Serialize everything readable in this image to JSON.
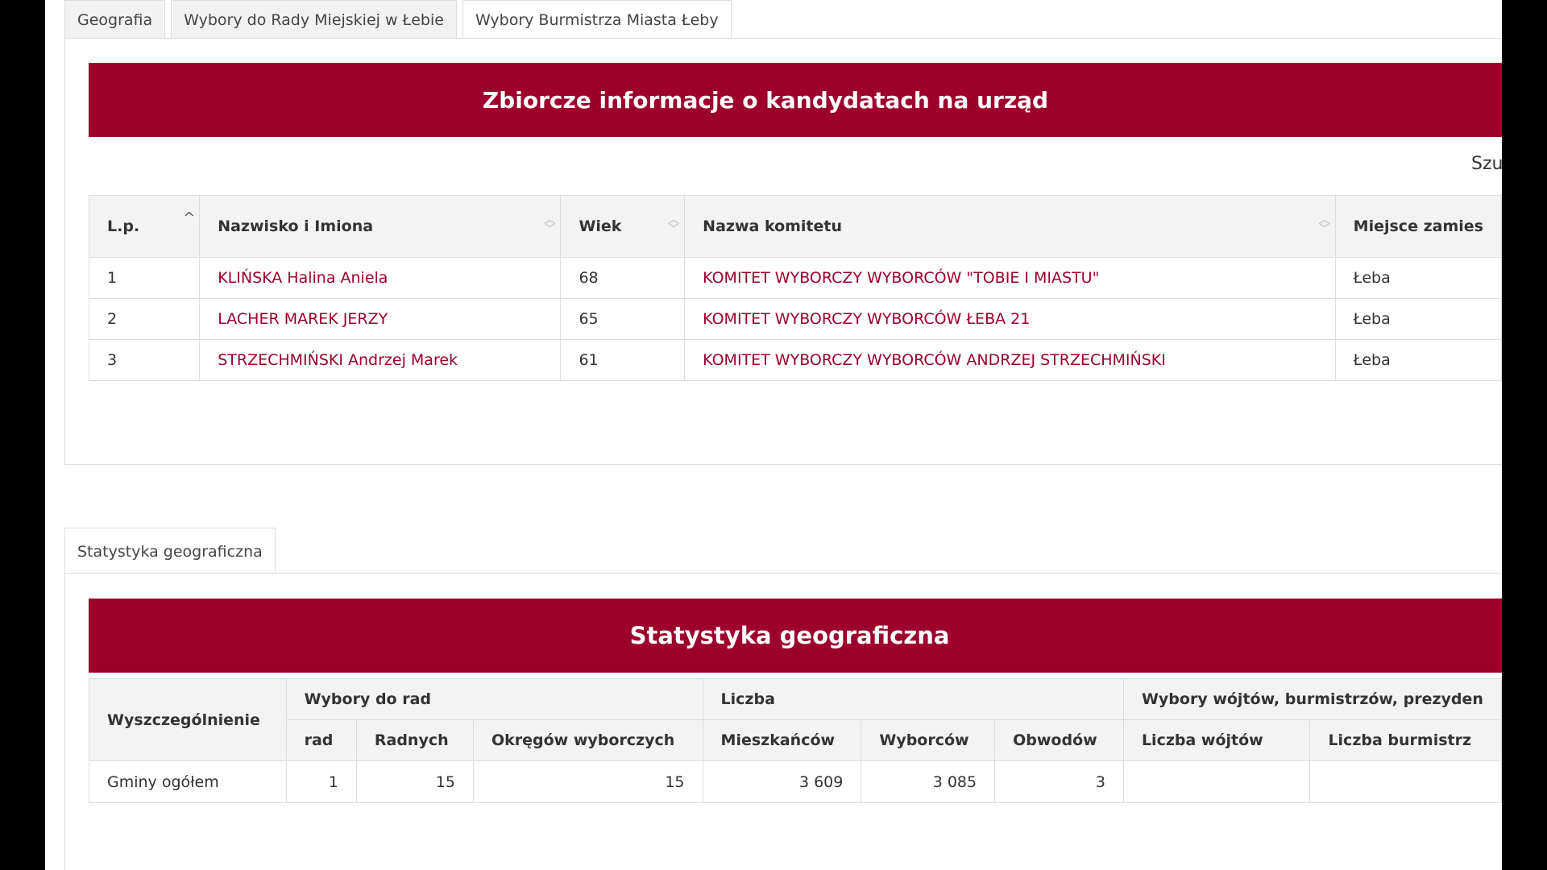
{
  "top_tabs": [
    {
      "label": "Geografia"
    },
    {
      "label": "Wybory do Rady Miejskiej w Łebie"
    },
    {
      "label": "Wybory Burmistrza Miasta Łeby"
    }
  ],
  "candidates": {
    "title": "Zbiorcze informacje o kandydatach na urząd",
    "search_label": "Szu",
    "columns": [
      "L.p.",
      "Nazwisko i Imiona",
      "Wiek",
      "Nazwa komitetu",
      "Miejsce zamies"
    ],
    "rows": [
      {
        "lp": "1",
        "name": "KLIŃSKA Halina Aniela",
        "age": "68",
        "committee": "KOMITET WYBORCZY WYBORCÓW \"TOBIE I MIASTU\"",
        "place": "Łeba"
      },
      {
        "lp": "2",
        "name": "LACHER MAREK JERZY",
        "age": "65",
        "committee": "KOMITET WYBORCZY WYBORCÓW ŁEBA 21",
        "place": "Łeba"
      },
      {
        "lp": "3",
        "name": "STRZECHMIŃSKI Andrzej Marek",
        "age": "61",
        "committee": "KOMITET WYBORCZY WYBORCÓW ANDRZEJ STRZECHMIŃSKI",
        "place": "Łeba"
      }
    ]
  },
  "bottom_tabs": [
    {
      "label": "Statystyka geograficzna"
    }
  ],
  "geo_stats": {
    "title": "Statystyka geograficzna",
    "group_headers": {
      "detail": "Wyszczególnienie",
      "councils": "Wybory do rad",
      "count": "Liczba",
      "mayors": "Wybory wójtów, burmistrzów, prezyden"
    },
    "sub_headers": [
      "rad",
      "Radnych",
      "Okręgów wyborczych",
      "Mieszkańców",
      "Wyborców",
      "Obwodów",
      "Liczba wójtów",
      "Liczba burmistrz"
    ],
    "row": {
      "label": "Gminy ogółem",
      "rad": "1",
      "radnych": "15",
      "okregow": "15",
      "mieszkancow": "3 609",
      "wyborcow": "3 085",
      "obwodow": "3",
      "wojtow": "",
      "burmistrzow": ""
    }
  }
}
